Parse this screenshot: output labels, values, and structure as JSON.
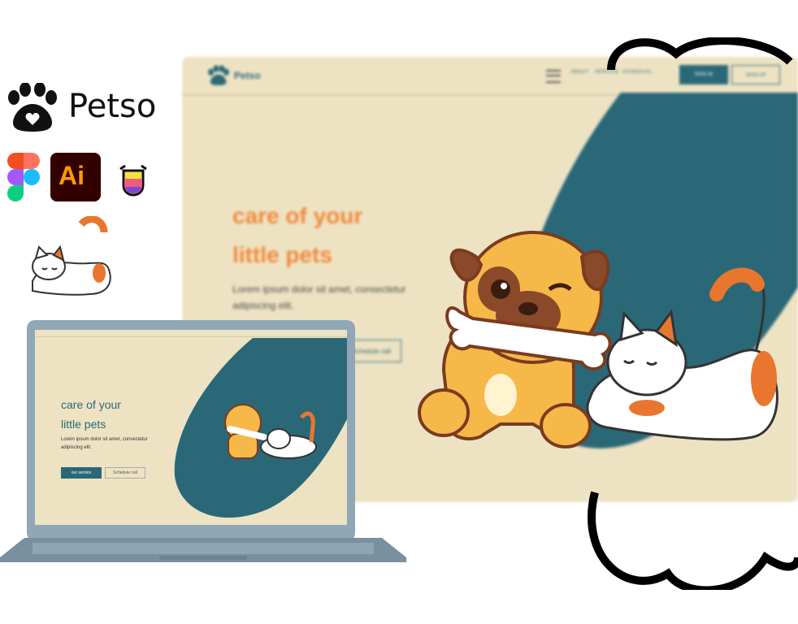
{
  "brand": {
    "name": "Petso"
  },
  "tools": [
    "figma-logo",
    "illustrator-logo",
    "glyph-app-logo"
  ],
  "tools_text": {
    "ai": "Ai"
  },
  "mockup": {
    "brand": "Petso",
    "nav_links": [
      "ABOUT",
      "SERVICE",
      "SCHEDUAL"
    ],
    "nav_buttons": [
      "SIGN IN",
      "SIGN UP"
    ],
    "hero_title_line1": "care of your",
    "hero_title_line2": "little pets",
    "hero_text_line1": "Lorem ipsum dolor sit amet, consectetur",
    "hero_text_line2": "adipiscing elit.",
    "secondary_button": "Schedule call"
  },
  "laptop": {
    "hero_title_line1": "care of your",
    "hero_title_line2": "little pets",
    "hero_text_line1": "Lorem ipsum dolor sit amet, consectetur",
    "hero_text_line2": "adipiscing elit.",
    "primary_button": "our service",
    "secondary_button": "Schedule call"
  },
  "colors": {
    "teal": "#2a6878",
    "cream": "#ede3c3",
    "orange": "#f2893b",
    "laptop": "#8fa7b6"
  }
}
